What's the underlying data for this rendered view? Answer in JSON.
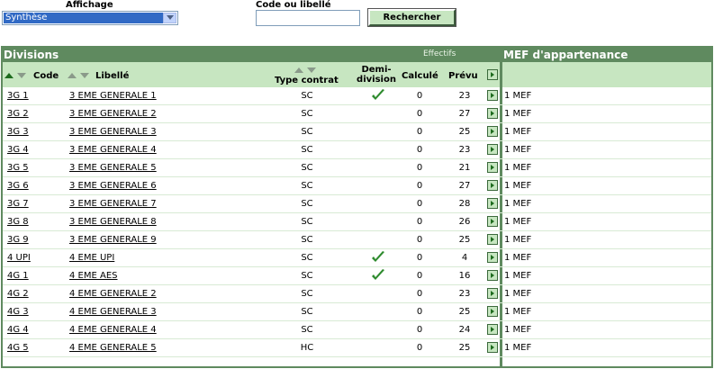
{
  "top": {
    "affichage_label": "Affichage",
    "affichage_value": "Synthèse",
    "code_label": "Code ou libellé",
    "code_value": "",
    "search_button": "Rechercher"
  },
  "table": {
    "divisions_title": "Divisions",
    "effectifs_title": "Effectifs",
    "mef_title": "MEF d'appartenance",
    "headers": {
      "code": "Code",
      "libelle": "Libellé",
      "type_contrat": "Type contrat",
      "demi_line1": "Demi-",
      "demi_line2": "division",
      "calcule": "Calculé",
      "prevu": "Prévu"
    },
    "rows": [
      {
        "code": "3G 1",
        "libelle": "3 EME GENERALE 1",
        "type": "SC",
        "demi": true,
        "calcule": "0",
        "prevu": "23",
        "mef": "1 MEF"
      },
      {
        "code": "3G 2",
        "libelle": "3 EME GENERALE 2",
        "type": "SC",
        "demi": false,
        "calcule": "0",
        "prevu": "27",
        "mef": "1 MEF"
      },
      {
        "code": "3G 3",
        "libelle": "3 EME GENERALE 3",
        "type": "SC",
        "demi": false,
        "calcule": "0",
        "prevu": "25",
        "mef": "1 MEF"
      },
      {
        "code": "3G 4",
        "libelle": "3 EME GENERALE 4",
        "type": "SC",
        "demi": false,
        "calcule": "0",
        "prevu": "23",
        "mef": "1 MEF"
      },
      {
        "code": "3G 5",
        "libelle": "3 EME GENERALE 5",
        "type": "SC",
        "demi": false,
        "calcule": "0",
        "prevu": "21",
        "mef": "1 MEF"
      },
      {
        "code": "3G 6",
        "libelle": "3 EME GENERALE 6",
        "type": "SC",
        "demi": false,
        "calcule": "0",
        "prevu": "27",
        "mef": "1 MEF"
      },
      {
        "code": "3G 7",
        "libelle": "3 EME GENERALE 7",
        "type": "SC",
        "demi": false,
        "calcule": "0",
        "prevu": "28",
        "mef": "1 MEF"
      },
      {
        "code": "3G 8",
        "libelle": "3 EME GENERALE 8",
        "type": "SC",
        "demi": false,
        "calcule": "0",
        "prevu": "26",
        "mef": "1 MEF"
      },
      {
        "code": "3G 9",
        "libelle": "3 EME GENERALE 9",
        "type": "SC",
        "demi": false,
        "calcule": "0",
        "prevu": "25",
        "mef": "1 MEF"
      },
      {
        "code": "4 UPI",
        "libelle": "4 EME UPI",
        "type": "SC",
        "demi": true,
        "calcule": "0",
        "prevu": "4",
        "mef": "1 MEF"
      },
      {
        "code": "4G 1",
        "libelle": "4 EME AES",
        "type": "SC",
        "demi": true,
        "calcule": "0",
        "prevu": "16",
        "mef": "1 MEF"
      },
      {
        "code": "4G 2",
        "libelle": "4 EME GENERALE 2",
        "type": "SC",
        "demi": false,
        "calcule": "0",
        "prevu": "23",
        "mef": "1 MEF"
      },
      {
        "code": "4G 3",
        "libelle": "4 EME GENERALE 3",
        "type": "SC",
        "demi": false,
        "calcule": "0",
        "prevu": "25",
        "mef": "1 MEF"
      },
      {
        "code": "4G 4",
        "libelle": "4 EME GENERALE 4",
        "type": "SC",
        "demi": false,
        "calcule": "0",
        "prevu": "24",
        "mef": "1 MEF"
      },
      {
        "code": "4G 5",
        "libelle": "4 EME GENERALE 5",
        "type": "HC",
        "demi": false,
        "calcule": "0",
        "prevu": "25",
        "mef": "1 MEF"
      }
    ]
  },
  "colors": {
    "header_dark": "#5f8a5f",
    "header_light": "#c7e6c1",
    "check": "#2e8b2e"
  }
}
